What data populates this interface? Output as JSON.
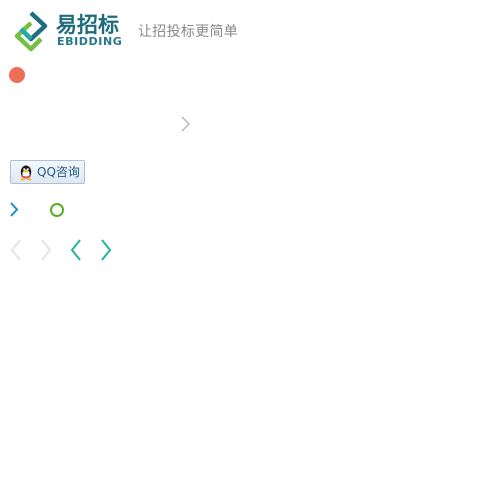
{
  "brand": {
    "name_cn": "易招标",
    "name_en": "EBIDDING",
    "slogan": "让招投标更简单",
    "colors": {
      "primary": "#1e6b7d",
      "accent_green": "#6fbf3e",
      "accent_teal": "#2aa7a0"
    }
  },
  "status_indicator": {
    "color": "#ef6f56"
  },
  "qq_button": {
    "label": "QQ咨询",
    "icon": "qq-penguin-icon"
  },
  "icons": {
    "grey_chevron": "chevron-right-icon",
    "blue_chevron": "chevron-right-icon",
    "green_ring": "circle-outline-icon"
  },
  "carousel": {
    "arrows": [
      {
        "direction": "prev",
        "state": "disabled",
        "color": "#e4e4e4"
      },
      {
        "direction": "next",
        "state": "disabled",
        "color": "#e4e4e4"
      },
      {
        "direction": "prev",
        "state": "active",
        "color": "#22b59a"
      },
      {
        "direction": "next",
        "state": "active",
        "color": "#22b59a"
      }
    ]
  }
}
